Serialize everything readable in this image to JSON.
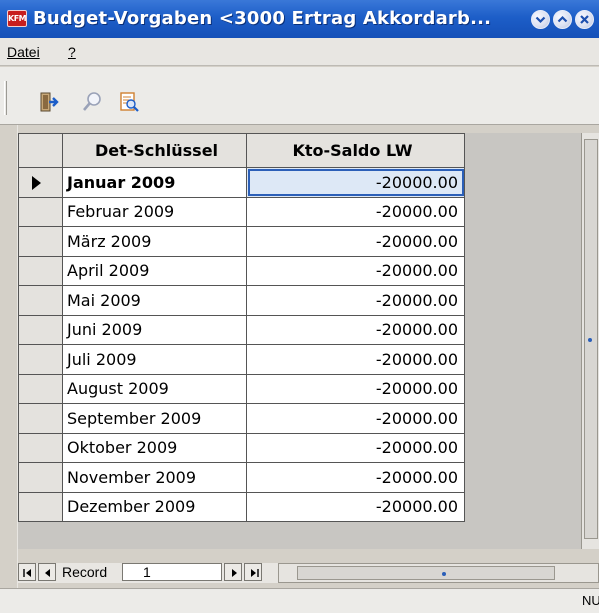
{
  "window": {
    "title": "Budget-Vorgaben <3000 Ertrag Akkordarb...",
    "app_icon_text": "KFM"
  },
  "menu": {
    "items": [
      {
        "label": "Datei"
      },
      {
        "label": "?"
      }
    ]
  },
  "toolbar": {
    "icons": [
      "exit-icon",
      "search-icon",
      "preview-icon"
    ]
  },
  "grid": {
    "columns": [
      "Det-Schlüssel",
      "Kto-Saldo LW"
    ],
    "rows": [
      {
        "key": "Januar 2009",
        "value": "-20000.00",
        "current": true
      },
      {
        "key": "Februar 2009",
        "value": "-20000.00"
      },
      {
        "key": "März 2009",
        "value": "-20000.00"
      },
      {
        "key": "April 2009",
        "value": "-20000.00"
      },
      {
        "key": "Mai 2009",
        "value": "-20000.00"
      },
      {
        "key": "Juni 2009",
        "value": "-20000.00"
      },
      {
        "key": "Juli 2009",
        "value": "-20000.00"
      },
      {
        "key": "August 2009",
        "value": "-20000.00"
      },
      {
        "key": "September 2009",
        "value": "-20000.00"
      },
      {
        "key": "Oktober 2009",
        "value": "-20000.00"
      },
      {
        "key": "November 2009",
        "value": "-20000.00"
      },
      {
        "key": "Dezember 2009",
        "value": "-20000.00"
      }
    ]
  },
  "navigator": {
    "record_label": "Record",
    "record_value": "1"
  },
  "status": {
    "text": "NU"
  },
  "colors": {
    "titlebar": "#1d5ec8",
    "selection_border": "#2b5fb8",
    "app_icon": "#c81e1e"
  }
}
